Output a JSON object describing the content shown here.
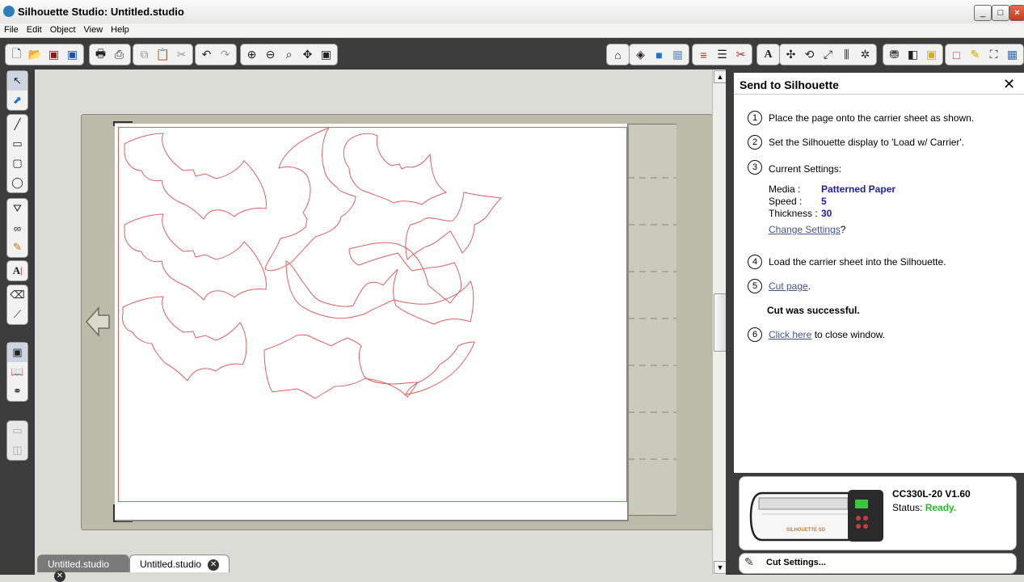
{
  "window": {
    "title": "Silhouette Studio: Untitled.studio"
  },
  "menu": {
    "items": [
      "File",
      "Edit",
      "Object",
      "View",
      "Help"
    ]
  },
  "tabs": [
    {
      "label": "Untitled.studio",
      "active": false
    },
    {
      "label": "Untitled.studio",
      "active": true
    }
  ],
  "panel": {
    "title": "Send to Silhouette",
    "steps": {
      "s1": {
        "num": "1",
        "text": "Place the page onto the carrier sheet as shown."
      },
      "s2": {
        "num": "2",
        "text": "Set the Silhouette display to 'Load w/ Carrier'."
      },
      "s3": {
        "num": "3",
        "text": "Current Settings:"
      },
      "s4": {
        "num": "4",
        "text": "Load the carrier sheet into the Silhouette."
      },
      "s5": {
        "num": "5",
        "link": "Cut page",
        "suffix": "."
      },
      "s6": {
        "num": "6",
        "link": "Click here",
        "suffix": " to close window."
      }
    },
    "settings": {
      "media_label": "Media :",
      "media_value": "Patterned Paper",
      "speed_label": "Speed :",
      "speed_value": "5",
      "thickness_label": "Thickness :",
      "thickness_value": "30",
      "change_link": "Change Settings",
      "change_suffix": "?"
    },
    "result": "Cut was successful."
  },
  "device": {
    "model": "CC330L-20 V1.60",
    "status_label": "Status:",
    "status_value": "Ready.",
    "brand": "SILHOUETTE SD"
  },
  "cut_settings": {
    "label": "Cut Settings..."
  },
  "colors": {
    "cut_line": "#e06060",
    "status_ready": "#2db52d",
    "setting_value": "#1d19c2"
  }
}
